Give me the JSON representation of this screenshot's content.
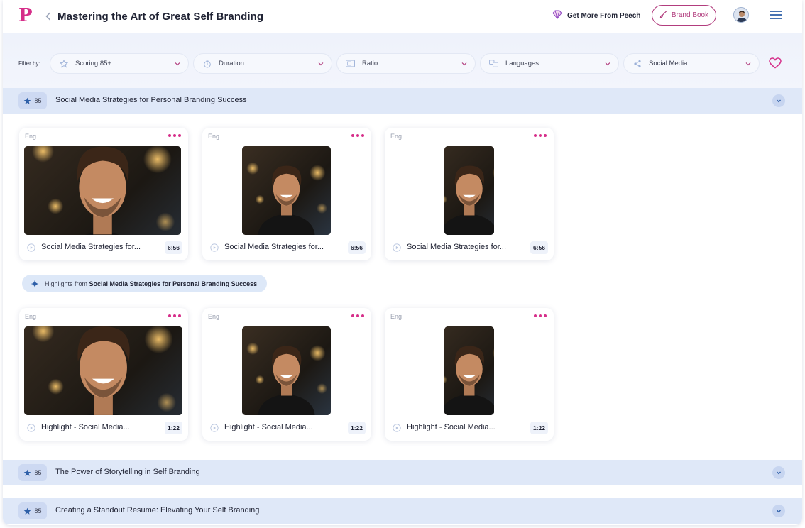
{
  "header": {
    "logo": "P",
    "title": "Mastering the Art of Great Self Branding",
    "get_more": "Get More From Peech",
    "brand_book": "Brand Book"
  },
  "filters": {
    "label": "Filter by:",
    "items": [
      {
        "label": "Scoring 85+",
        "icon": "star-outline-icon"
      },
      {
        "label": "Duration",
        "icon": "stopwatch-icon"
      },
      {
        "label": "Ratio",
        "icon": "aspect-ratio-icon"
      },
      {
        "label": "Languages",
        "icon": "translate-icon"
      },
      {
        "label": "Social Media",
        "icon": "share-icon"
      }
    ]
  },
  "sections": [
    {
      "score": "85",
      "title": "Social Media Strategies for Personal Branding Success",
      "videos": [
        {
          "lang": "Eng",
          "title": "Social Media Strategies for...",
          "duration": "6:56",
          "ratio": "16:9"
        },
        {
          "lang": "Eng",
          "title": "Social Media Strategies for...",
          "duration": "6:56",
          "ratio": "1:1"
        },
        {
          "lang": "Eng",
          "title": "Social Media Strategies for...",
          "duration": "6:56",
          "ratio": "9:16"
        }
      ],
      "highlights": {
        "prefix": "Highlights from",
        "source": "Social Media Strategies for Personal Branding Success"
      },
      "highlight_videos": [
        {
          "lang": "Eng",
          "title": "Highlight - Social Media...",
          "duration": "1:22",
          "ratio": "16:9"
        },
        {
          "lang": "Eng",
          "title": "Highlight - Social Media...",
          "duration": "1:22",
          "ratio": "1:1"
        },
        {
          "lang": "Eng",
          "title": "Highlight - Social Media...",
          "duration": "1:22",
          "ratio": "9:16"
        }
      ]
    },
    {
      "score": "85",
      "title": "The Power of Storytelling in Self Branding"
    },
    {
      "score": "85",
      "title": "Creating a Standout Resume: Elevating Your Self Branding"
    }
  ],
  "colors": {
    "brand": "#d62f8a",
    "accent_blue": "#2d5fa8",
    "section_bg": "#dfe8f8"
  }
}
